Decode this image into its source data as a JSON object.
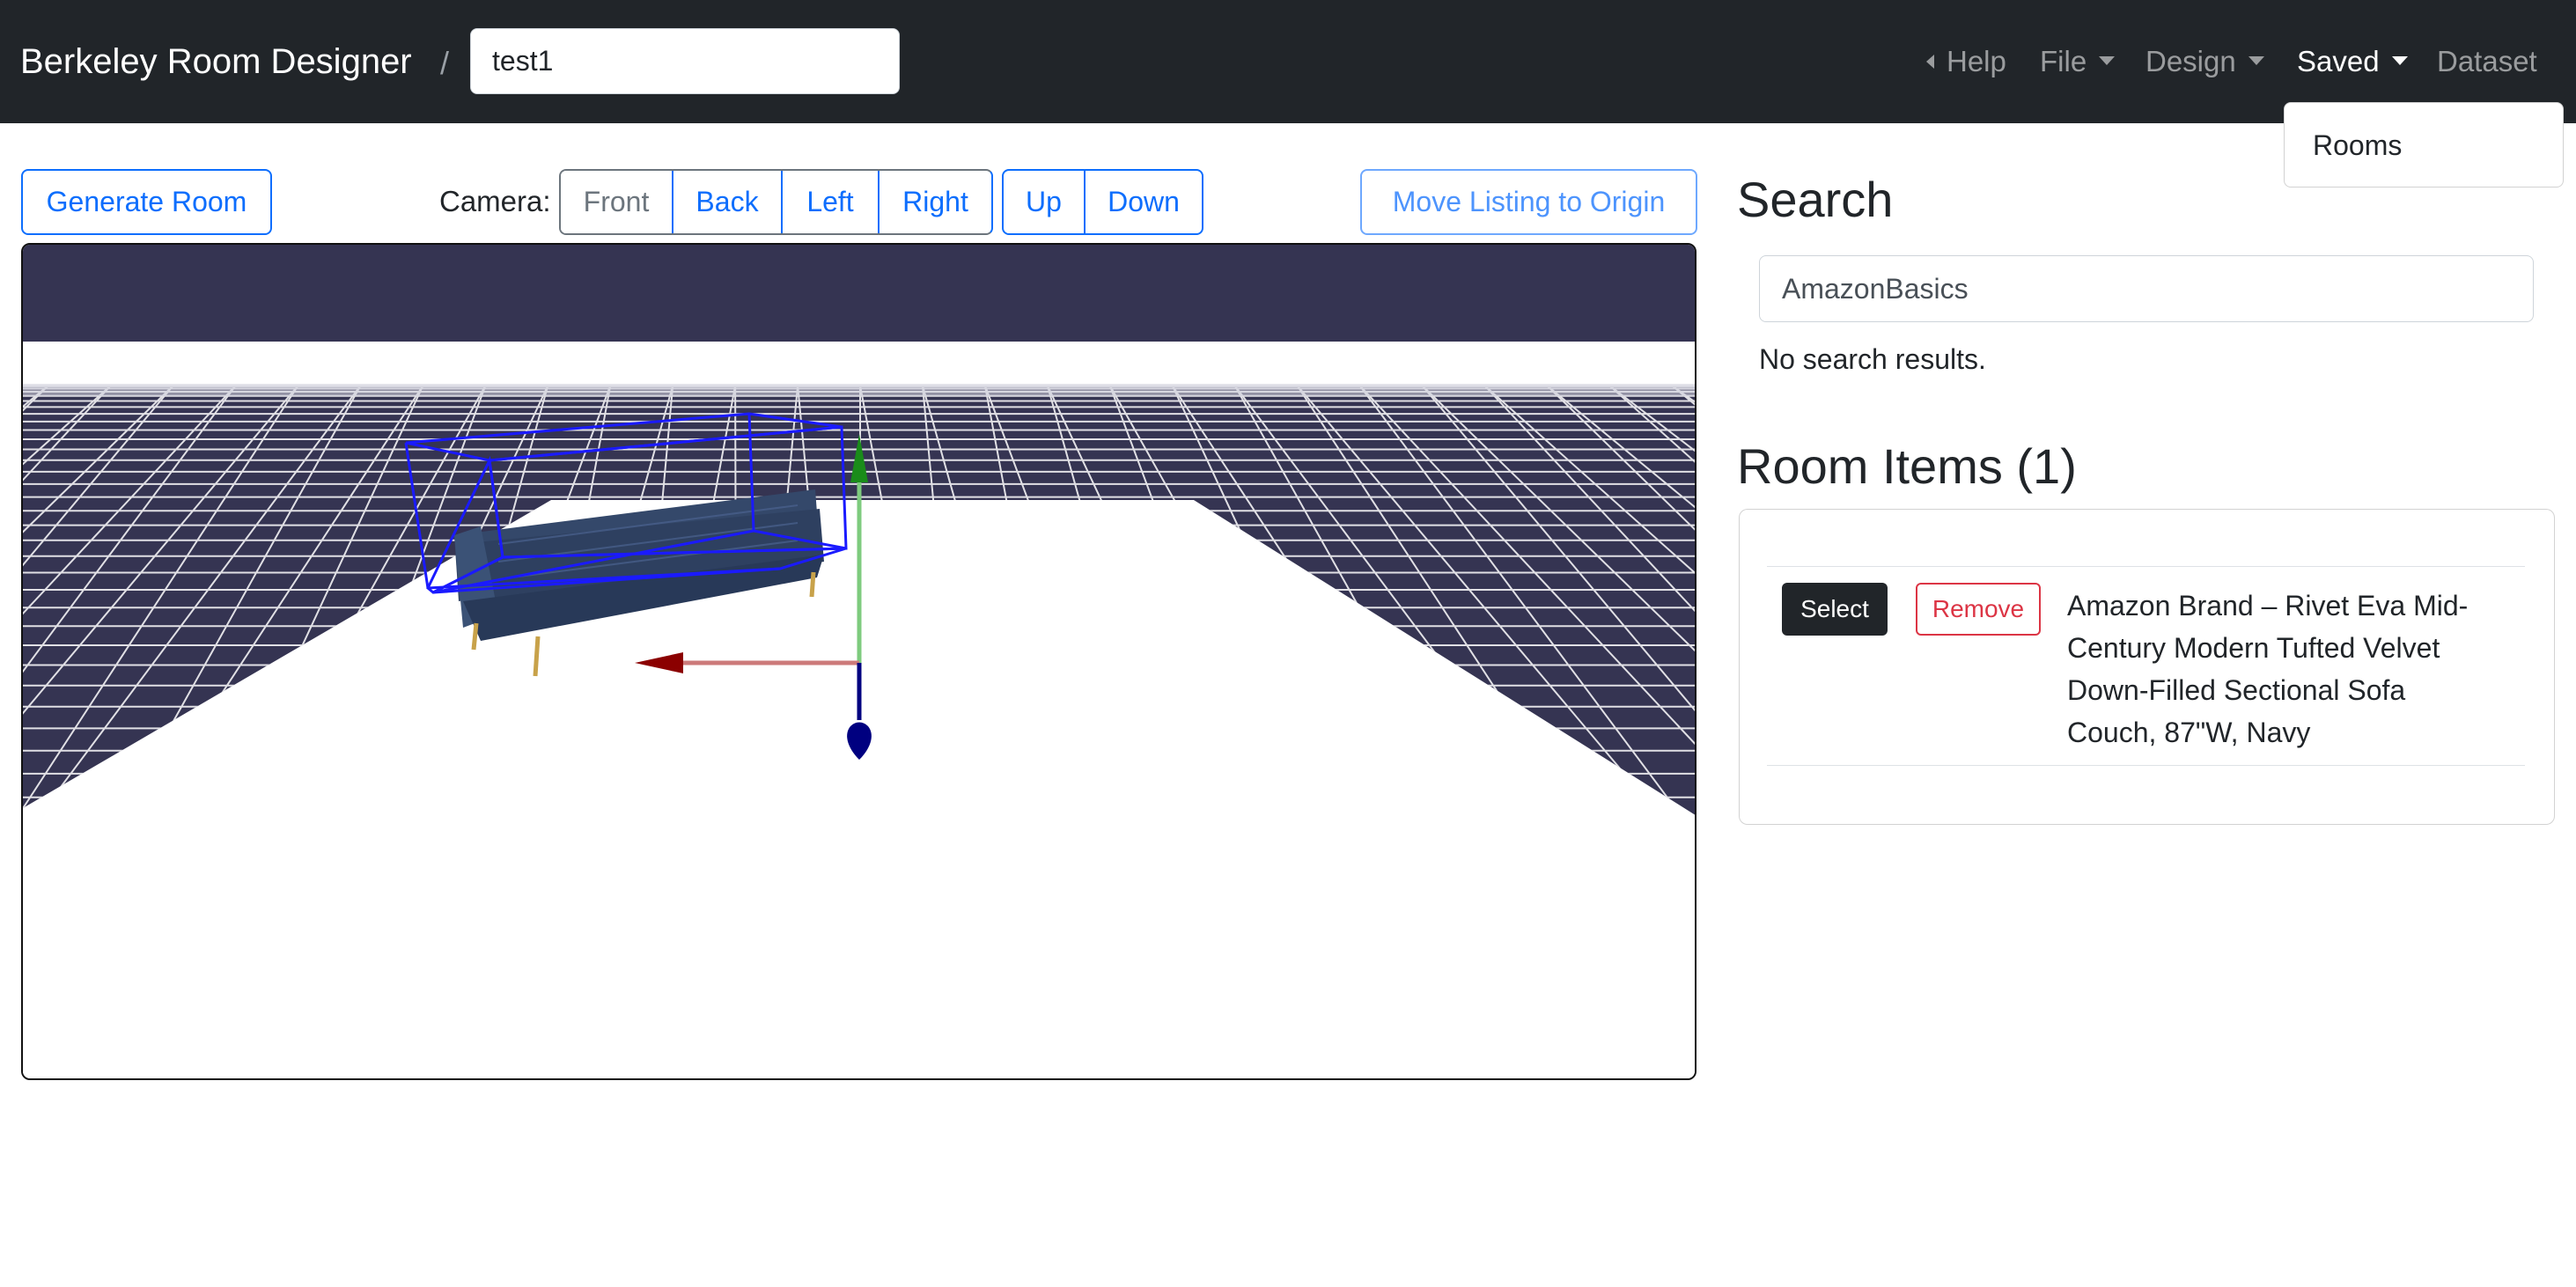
{
  "navbar": {
    "brand": "Berkeley Room Designer",
    "separator": "/",
    "room_name": "test1",
    "help": "Help",
    "menu": {
      "file": "File",
      "design": "Design",
      "saved": "Saved",
      "dataset": "Dataset"
    },
    "saved_dropdown": {
      "items": [
        "Rooms"
      ]
    }
  },
  "toolbar": {
    "generate_room": "Generate Room",
    "camera_label": "Camera:",
    "camera": {
      "front": "Front",
      "back": "Back",
      "left": "Left",
      "right": "Right",
      "up": "Up",
      "down": "Down",
      "selected": "Front"
    },
    "move_to_origin": "Move Listing to Origin"
  },
  "scene": {
    "background_color": "#353452",
    "floor_color": "#ffffff",
    "selected_item_box_color": "#1a1aff",
    "gizmo": {
      "x_axis_color": "#8b0000",
      "y_axis_color": "#1a8c1a",
      "z_axis_color": "#000080"
    }
  },
  "search": {
    "heading": "Search",
    "query": "AmazonBasics",
    "empty_message": "No search results."
  },
  "room_items": {
    "heading": "Room Items (1)",
    "items": [
      {
        "select_label": "Select",
        "remove_label": "Remove",
        "title_lines": [
          "Amazon Brand – Rivet Eva Mid-",
          "Century Modern Tufted Velvet",
          "Down-Filled Sectional Sofa",
          "Couch, 87\"W, Navy"
        ]
      }
    ]
  }
}
